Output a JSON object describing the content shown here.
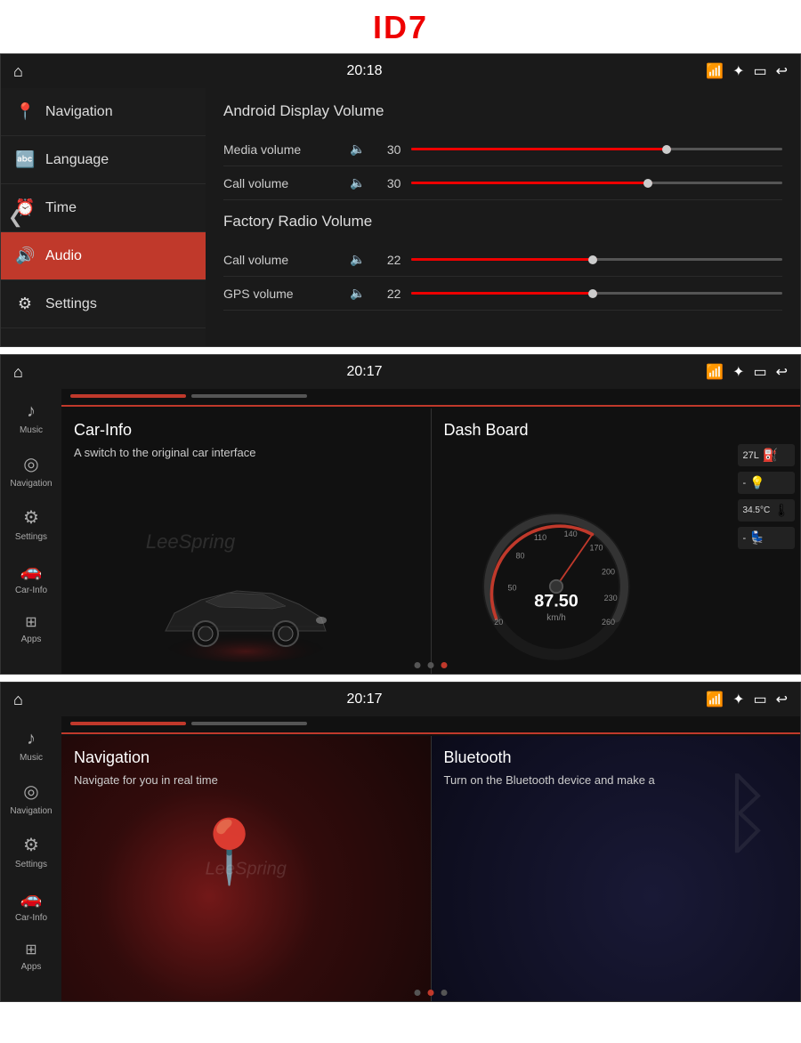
{
  "title": "ID7",
  "screen1": {
    "time": "20:18",
    "sidebar": {
      "items": [
        {
          "label": "Navigation",
          "icon": "📍",
          "active": false
        },
        {
          "label": "Language",
          "icon": "🔤",
          "active": false
        },
        {
          "label": "Time",
          "icon": "⏰",
          "active": false
        },
        {
          "label": "Audio",
          "icon": "🔊",
          "active": true
        },
        {
          "label": "Settings",
          "icon": "⚙",
          "active": false
        }
      ]
    },
    "main": {
      "android_title": "Android Display Volume",
      "media_label": "Media volume",
      "media_value": "30",
      "call_label1": "Call volume",
      "call_value1": "30",
      "factory_title": "Factory Radio Volume",
      "call_label2": "Call volume",
      "call_value2": "22",
      "gps_label": "GPS volume",
      "gps_value": "22"
    }
  },
  "screen2": {
    "time": "20:17",
    "sidebar_items": [
      {
        "label": "Music",
        "icon": "♪"
      },
      {
        "label": "Navigation",
        "icon": "◎"
      },
      {
        "label": "Settings",
        "icon": "⚙"
      },
      {
        "label": "Car-Info",
        "icon": "🚗"
      },
      {
        "label": "Apps",
        "icon": "⊞"
      }
    ],
    "card1": {
      "title": "Car-Info",
      "desc": "A switch to the original car interface"
    },
    "card2": {
      "title": "Dash Board",
      "speed": "87.50",
      "unit": "km/h",
      "fuel": "27L",
      "temp": "34.5°C"
    },
    "dots": [
      false,
      false,
      true
    ]
  },
  "screen3": {
    "time": "20:17",
    "sidebar_items": [
      {
        "label": "Music",
        "icon": "♪"
      },
      {
        "label": "Navigation",
        "icon": "◎"
      },
      {
        "label": "Settings",
        "icon": "⚙"
      },
      {
        "label": "Car-Info",
        "icon": "🚗"
      },
      {
        "label": "Apps",
        "icon": "⊞"
      }
    ],
    "card1": {
      "title": "Navigation",
      "desc": "Navigate for you in real time"
    },
    "card2": {
      "title": "Bluetooth",
      "desc": "Turn on the Bluetooth device and make a"
    },
    "dots": [
      false,
      true,
      false
    ]
  },
  "icons": {
    "home": "⌂",
    "wifi": "📶",
    "bluetooth": "🔵",
    "window": "▭",
    "back": "↩",
    "chevron_left": "❮"
  }
}
